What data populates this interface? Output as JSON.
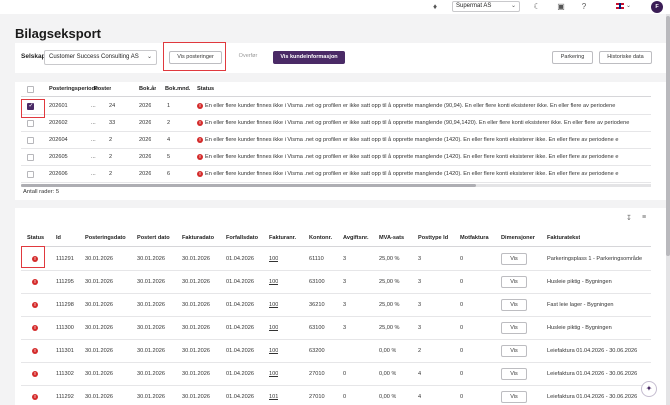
{
  "topbar": {
    "company": "Supermat AS",
    "icons": [
      "bell-icon",
      "moon-icon",
      "lock-icon",
      "help-icon",
      "flag-uk-icon"
    ],
    "avatar_initial": "F"
  },
  "page": {
    "title": "Bilagseksport"
  },
  "filter": {
    "company_label": "Selskap",
    "company_value": "Customer Success Consulting AS",
    "btn_vis_posteringer": "Vis posteringer",
    "btn_overfor": "Overfør",
    "btn_vis_kundeinformasjon": "Vis kundeinformasjon",
    "btn_parkering": "Parkering",
    "btn_historiske_data": "Historiske data"
  },
  "top_table": {
    "headers": [
      "Posteringsperiode",
      "Poster",
      "Bok.år",
      "Bok.mnd.",
      "Status"
    ],
    "rows": [
      {
        "periode": "202601",
        "dots": "...",
        "poster": "24",
        "ar": "2026",
        "mnd": "1",
        "checked": true,
        "status": "En eller flere kunder finnes ikke i Visma .net og profilen er ikke satt opp til å opprette manglende (90,94). En eller flere konti eksisterer ikke. En eller flere av periodene"
      },
      {
        "periode": "202602",
        "dots": "...",
        "poster": "33",
        "ar": "2026",
        "mnd": "2",
        "checked": false,
        "status": "En eller flere kunder finnes ikke i Visma .net og profilen er ikke satt opp til å opprette manglende (90,94,1420). En eller flere konti eksisterer ikke. En eller flere av periodene"
      },
      {
        "periode": "202604",
        "dots": "...",
        "poster": "2",
        "ar": "2026",
        "mnd": "4",
        "checked": false,
        "status": "En eller flere kunder finnes ikke i Visma .net og profilen er ikke satt opp til å opprette manglende (1420). En eller flere konti eksisterer ikke. En eller flere av periodene e"
      },
      {
        "periode": "202605",
        "dots": "...",
        "poster": "2",
        "ar": "2026",
        "mnd": "5",
        "checked": false,
        "status": "En eller flere kunder finnes ikke i Visma .net og profilen er ikke satt opp til å opprette manglende (1420). En eller flere konti eksisterer ikke. En eller flere av periodene e"
      },
      {
        "periode": "202606",
        "dots": "...",
        "poster": "2",
        "ar": "2026",
        "mnd": "6",
        "checked": false,
        "status": "En eller flere kunder finnes ikke i Visma .net og profilen er ikke satt opp til å opprette manglende (1420). En eller flere konti eksisterer ikke. En eller flere av periodene e"
      }
    ],
    "count_label": "Antall rader: 5"
  },
  "bottom_table": {
    "headers": [
      "Status",
      "Id",
      "Posteringsdato",
      "Postert dato",
      "Fakturadato",
      "Forfallsdato",
      "Fakturanr.",
      "Kontonr.",
      "Avgiftsnr.",
      "MVA-sats",
      "Posttype Id",
      "Motfaktura",
      "Dimensjoner",
      "Fakturatekst"
    ],
    "vis_label": "Vis",
    "rows": [
      {
        "id": "111291",
        "pdato": "30.01.2026",
        "postert": "30.01.2026",
        "fdato": "30.01.2026",
        "forfall": "01.04.2026",
        "fnr": "100",
        "konto": "61110",
        "avg": "3",
        "mva": "25,00 %",
        "ptype": "3",
        "mot": "0",
        "tekst": "Parkeringsplass 1 - Parkeringsområde"
      },
      {
        "id": "111295",
        "pdato": "30.01.2026",
        "postert": "30.01.2026",
        "fdato": "30.01.2026",
        "forfall": "01.04.2026",
        "fnr": "100",
        "konto": "63100",
        "avg": "3",
        "mva": "25,00 %",
        "ptype": "3",
        "mot": "0",
        "tekst": "Husleie piktig - Bygningen"
      },
      {
        "id": "111298",
        "pdato": "30.01.2026",
        "postert": "30.01.2026",
        "fdato": "30.01.2026",
        "forfall": "01.04.2026",
        "fnr": "100",
        "konto": "36210",
        "avg": "3",
        "mva": "25,00 %",
        "ptype": "3",
        "mot": "0",
        "tekst": "Fast leie lager - Bygningen"
      },
      {
        "id": "111300",
        "pdato": "30.01.2026",
        "postert": "30.01.2026",
        "fdato": "30.01.2026",
        "forfall": "01.04.2026",
        "fnr": "100",
        "konto": "63100",
        "avg": "3",
        "mva": "25,00 %",
        "ptype": "3",
        "mot": "0",
        "tekst": "Husleie piktig - Bygningen"
      },
      {
        "id": "111301",
        "pdato": "30.01.2026",
        "postert": "30.01.2026",
        "fdato": "30.01.2026",
        "forfall": "01.04.2026",
        "fnr": "100",
        "konto": "63200",
        "avg": "",
        "mva": "0,00 %",
        "ptype": "2",
        "mot": "0",
        "tekst": "Leiefaktura 01.04.2026 - 30.06.2026"
      },
      {
        "id": "111302",
        "pdato": "30.01.2026",
        "postert": "30.01.2026",
        "fdato": "30.01.2026",
        "forfall": "01.04.2026",
        "fnr": "100",
        "konto": "27010",
        "avg": "0",
        "mva": "0,00 %",
        "ptype": "4",
        "mot": "0",
        "tekst": "Leiefaktura 01.04.2026 - 30.06.2026"
      },
      {
        "id": "111292",
        "pdato": "30.01.2026",
        "postert": "30.01.2026",
        "fdato": "30.01.2026",
        "forfall": "01.04.2026",
        "fnr": "101",
        "konto": "27010",
        "avg": "0",
        "mva": "0,00 %",
        "ptype": "4",
        "mot": "0",
        "tekst": "Leiefaktura 01.04.2026 - 30.06.2026"
      }
    ]
  },
  "colors": {
    "accent": "#4a2a66",
    "error": "#d42b2b",
    "highlight": "#e0393e"
  }
}
